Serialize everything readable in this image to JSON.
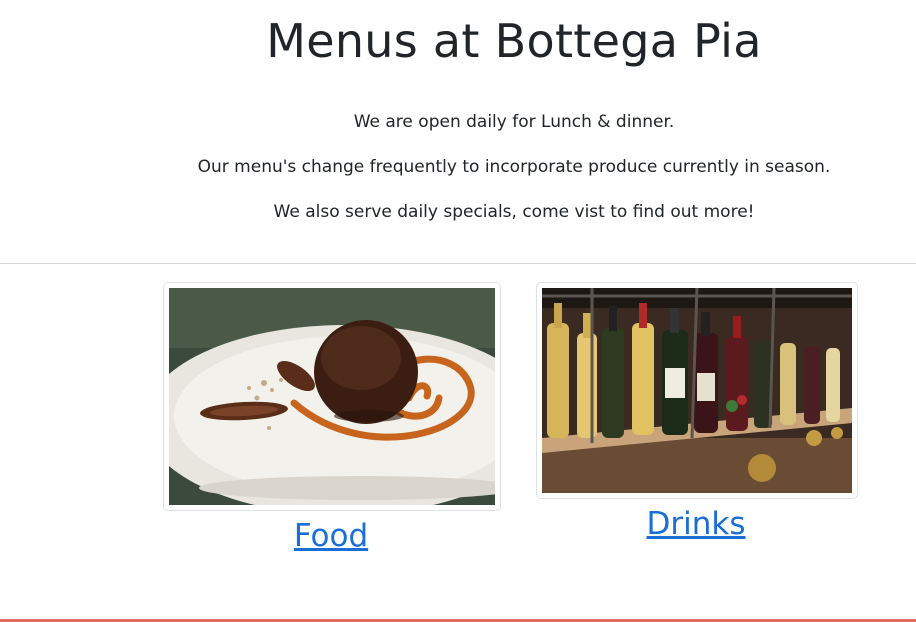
{
  "page": {
    "title": "Menus at Bottega Pia",
    "intro": [
      "We are open daily for Lunch & dinner.",
      "Our menu's change frequently to incorporate produce currently in season.",
      "We also serve daily specials, come vist to find out more!"
    ]
  },
  "menus": [
    {
      "label": "Food",
      "image": "chocolate-dessert-plate-image"
    },
    {
      "label": "Drinks",
      "image": "wine-bottle-shelf-image"
    }
  ],
  "colors": {
    "link": "#1a6fd6",
    "text": "#212529",
    "footer_border": "#e06d62"
  }
}
